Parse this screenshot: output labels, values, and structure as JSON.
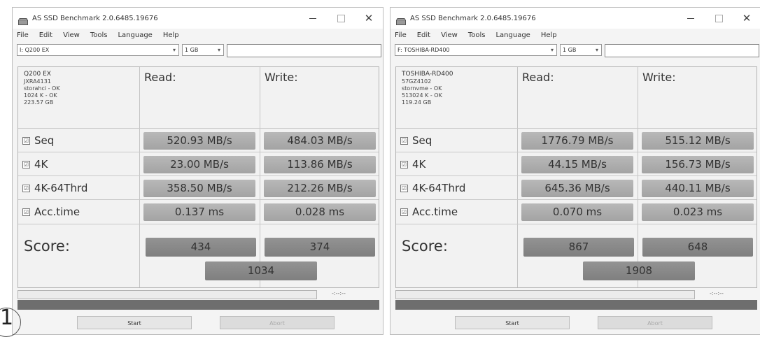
{
  "colors": {
    "window_bg": "#f4f4f4",
    "value_bar": "#b8b8b8",
    "score_bar": "#8a8a8a",
    "status_strip": "#6e6e6e"
  },
  "marker": "1",
  "windows": [
    {
      "title": "AS SSD Benchmark 2.0.6485.19676",
      "caption": {
        "minimize": "—",
        "maximize": "☐",
        "close": "✕"
      },
      "menu": [
        "File",
        "Edit",
        "View",
        "Tools",
        "Language",
        "Help"
      ],
      "drive_select": "I: Q200 EX",
      "size_select": "1 GB",
      "drive_info": {
        "name": "Q200 EX",
        "firmware": "JXRA4131",
        "driver": "storahci - OK",
        "alignment": "1024 K - OK",
        "capacity": "223.57 GB"
      },
      "headers": {
        "read": "Read:",
        "write": "Write:"
      },
      "rows": [
        {
          "label": "Seq",
          "checked": "☑",
          "read": "520.93 MB/s",
          "write": "484.03 MB/s"
        },
        {
          "label": "4K",
          "checked": "☑",
          "read": "23.00 MB/s",
          "write": "113.86 MB/s"
        },
        {
          "label": "4K-64Thrd",
          "checked": "☑",
          "read": "358.50 MB/s",
          "write": "212.26 MB/s"
        },
        {
          "label": "Acc.time",
          "checked": "☑",
          "read": "0.137 ms",
          "write": "0.028 ms"
        }
      ],
      "score": {
        "label": "Score:",
        "read": "434",
        "write": "374",
        "total": "1034"
      },
      "progress_time": "-:--:--",
      "buttons": {
        "start": "Start",
        "abort": "Abort"
      }
    },
    {
      "title": "AS SSD Benchmark 2.0.6485.19676",
      "caption": {
        "minimize": "—",
        "maximize": "☐",
        "close": "✕"
      },
      "menu": [
        "File",
        "Edit",
        "View",
        "Tools",
        "Language",
        "Help"
      ],
      "drive_select": "F: TOSHIBA-RD400",
      "size_select": "1 GB",
      "drive_info": {
        "name": "TOSHIBA-RD400",
        "firmware": "57GZ4102",
        "driver": "stornvme - OK",
        "alignment": "513024 K - OK",
        "capacity": "119.24 GB"
      },
      "headers": {
        "read": "Read:",
        "write": "Write:"
      },
      "rows": [
        {
          "label": "Seq",
          "checked": "☑",
          "read": "1776.79 MB/s",
          "write": "515.12 MB/s"
        },
        {
          "label": "4K",
          "checked": "☑",
          "read": "44.15 MB/s",
          "write": "156.73 MB/s"
        },
        {
          "label": "4K-64Thrd",
          "checked": "☑",
          "read": "645.36 MB/s",
          "write": "440.11 MB/s"
        },
        {
          "label": "Acc.time",
          "checked": "☑",
          "read": "0.070 ms",
          "write": "0.023 ms"
        }
      ],
      "score": {
        "label": "Score:",
        "read": "867",
        "write": "648",
        "total": "1908"
      },
      "progress_time": "-:--:--",
      "buttons": {
        "start": "Start",
        "abort": "Abort"
      }
    }
  ]
}
